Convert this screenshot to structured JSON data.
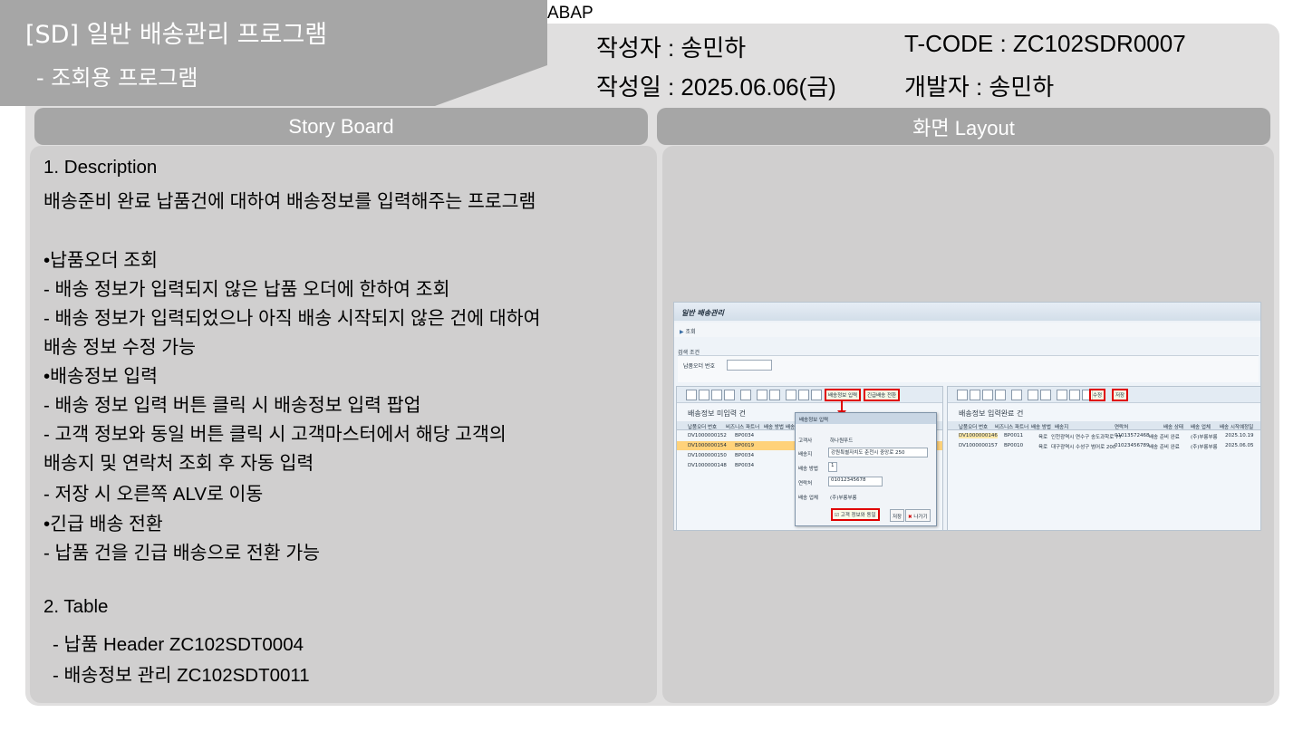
{
  "header": {
    "title": "[SD] 일반 배송관리 프로그램",
    "subtitle": "- 조회용 프로그램",
    "tag": "ABAP",
    "author_line": "작성자 : 송민하",
    "date_line": "작성일 : 2025.06.06(금)",
    "tcode_line": "T-CODE  : ZC102SDR0007",
    "developer_line": "개발자    : 송민하"
  },
  "sections": {
    "story_board": "Story Board",
    "screen_layout": "화면 Layout"
  },
  "story": {
    "desc_heading": "1.   Description",
    "desc_text": "배송준비 완료 납품건에 대하여 배송정보를 입력해주는 프로그램",
    "bullet1_title": "•납품오더 조회",
    "bullet1_l1": "  - 배송 정보가 입력되지 않은 납품 오더에 한하여 조회",
    "bullet1_l2": "  - 배송 정보가 입력되었으나 아직 배송 시작되지 않은 건에 대하여",
    "bullet1_l3": "배송 정보 수정 가능",
    "bullet2_title": "•배송정보 입력",
    "bullet2_l1": "  - 배송 정보 입력 버튼 클릭 시 배송정보 입력 팝업",
    "bullet2_l2": "  - 고객 정보와 동일 버튼 클릭 시 고객마스터에서 해당 고객의",
    "bullet2_l3": "배송지 및 연락처 조회 후 자동 입력",
    "bullet2_l4": "  - 저장 시 오른쪽 ALV로 이동",
    "bullet3_title": "•긴급 배송 전환",
    "bullet3_l1": " -  납품 건을 긴급 배송으로 전환 가능",
    "table_heading": "2. Table",
    "table_l1": "-     납품 Header ZC102SDT0004",
    "table_l2": "-     배송정보 관리 ZC102SDT0011"
  },
  "sap": {
    "window_title": "일반 배송관리",
    "toolbar_search": "조회",
    "selection_title": "검색 조건",
    "selection_label": "납품오더 번호",
    "left_title": "배송정보 미입력 건",
    "right_title": "배송정보 입력완료 건",
    "btn_input": "배송정보 입력",
    "btn_urgent": "긴급배송 전환",
    "btn_edit": "수정",
    "btn_save": "저장",
    "left_cols": [
      "납품오더 번호",
      "비즈니스 파트너",
      "배송 방법",
      "배송"
    ],
    "left_rows": [
      [
        "DV1000000152",
        "BP0034"
      ],
      [
        "DV1000000154",
        "BP0019"
      ],
      [
        "DV1000000150",
        "BP0034"
      ],
      [
        "DV1000000148",
        "BP0034"
      ]
    ],
    "right_cols": [
      "납품오더 번호",
      "비즈니스 파트너",
      "배송 방법",
      "배송지",
      "연락처",
      "배송 상태",
      "배송 업체",
      "배송 시작예정일"
    ],
    "right_rows": [
      [
        "DV1000000146",
        "BP0011",
        "육로",
        "인천광역시 연수구 송도과학로 77",
        "01013572468",
        "배송 준비 완료",
        "(주)부릉부릉",
        "2025.10.19"
      ],
      [
        "DV1000000157",
        "BP0010",
        "육로",
        "대구광역시 수성구 범어로 200",
        "01023456789",
        "배송 준비 완료",
        "(주)부릉부릉",
        "2025.06.05"
      ]
    ],
    "popup": {
      "title": "배송정보 입력",
      "customer_label": "고객사",
      "customer_value": "하나원푸드",
      "address_label": "배송지",
      "address_value": "강원특별자치도 춘천시 중앙로 250",
      "method_label": "배송 방법",
      "method_value": "1",
      "phone_label": "연락처",
      "phone_value": "01012345678",
      "carrier_label": "배송 업체",
      "carrier_value": "(주)부릉부릉",
      "btn_same": "고객 정보와 동일",
      "btn_save": "저장",
      "btn_exit": "나가기"
    }
  }
}
